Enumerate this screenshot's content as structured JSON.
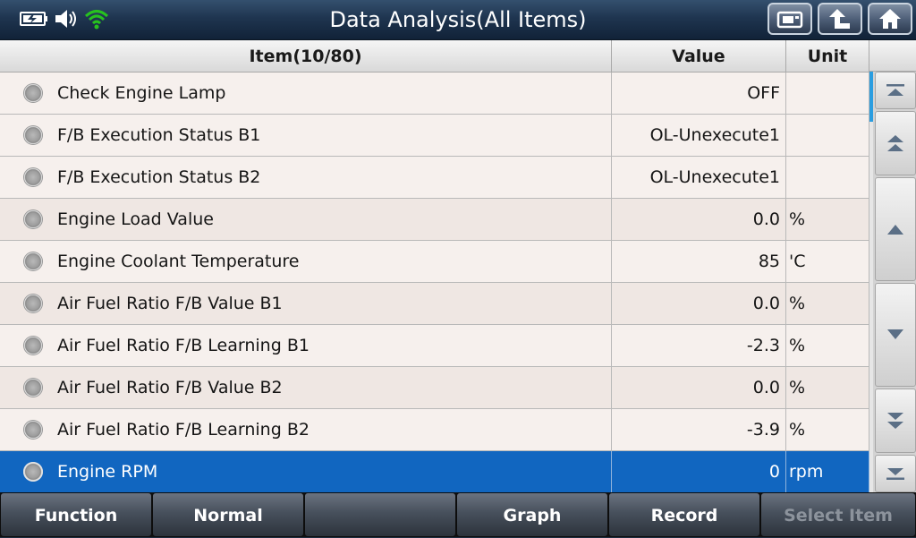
{
  "title": "Data Analysis(All Items)",
  "status_icons": [
    "battery-icon",
    "speaker-icon",
    "wifi-icon"
  ],
  "header_buttons": [
    "print-icon",
    "back-icon",
    "home-icon"
  ],
  "columns": {
    "item": "Item(10/80)",
    "value": "Value",
    "unit": "Unit"
  },
  "rows": [
    {
      "item": "Check Engine Lamp",
      "value": "OFF",
      "unit": ""
    },
    {
      "item": "F/B Execution Status B1",
      "value": "OL-Unexecute1",
      "unit": ""
    },
    {
      "item": "F/B Execution Status B2",
      "value": "OL-Unexecute1",
      "unit": ""
    },
    {
      "item": "Engine Load Value",
      "value": "0.0",
      "unit": "%"
    },
    {
      "item": "Engine Coolant Temperature",
      "value": "85",
      "unit": "'C"
    },
    {
      "item": "Air Fuel Ratio F/B Value B1",
      "value": "0.0",
      "unit": "%"
    },
    {
      "item": "Air Fuel Ratio F/B Learning B1",
      "value": "-2.3",
      "unit": "%"
    },
    {
      "item": "Air Fuel Ratio F/B Value B2",
      "value": "0.0",
      "unit": "%"
    },
    {
      "item": "Air Fuel Ratio F/B Learning B2",
      "value": "-3.9",
      "unit": "%"
    },
    {
      "item": "Engine RPM",
      "value": "0",
      "unit": "rpm"
    }
  ],
  "selected_row": "Engine RPM",
  "bottom_bar": {
    "function": "Function",
    "normal": "Normal",
    "empty": "",
    "graph": "Graph",
    "record": "Record",
    "select_item": "Select Item"
  },
  "colors": {
    "titlebar": "#1f3550",
    "selected": "#1166c0",
    "scroll_thumb": "#2a9de0",
    "wifi": "#27c21e"
  }
}
